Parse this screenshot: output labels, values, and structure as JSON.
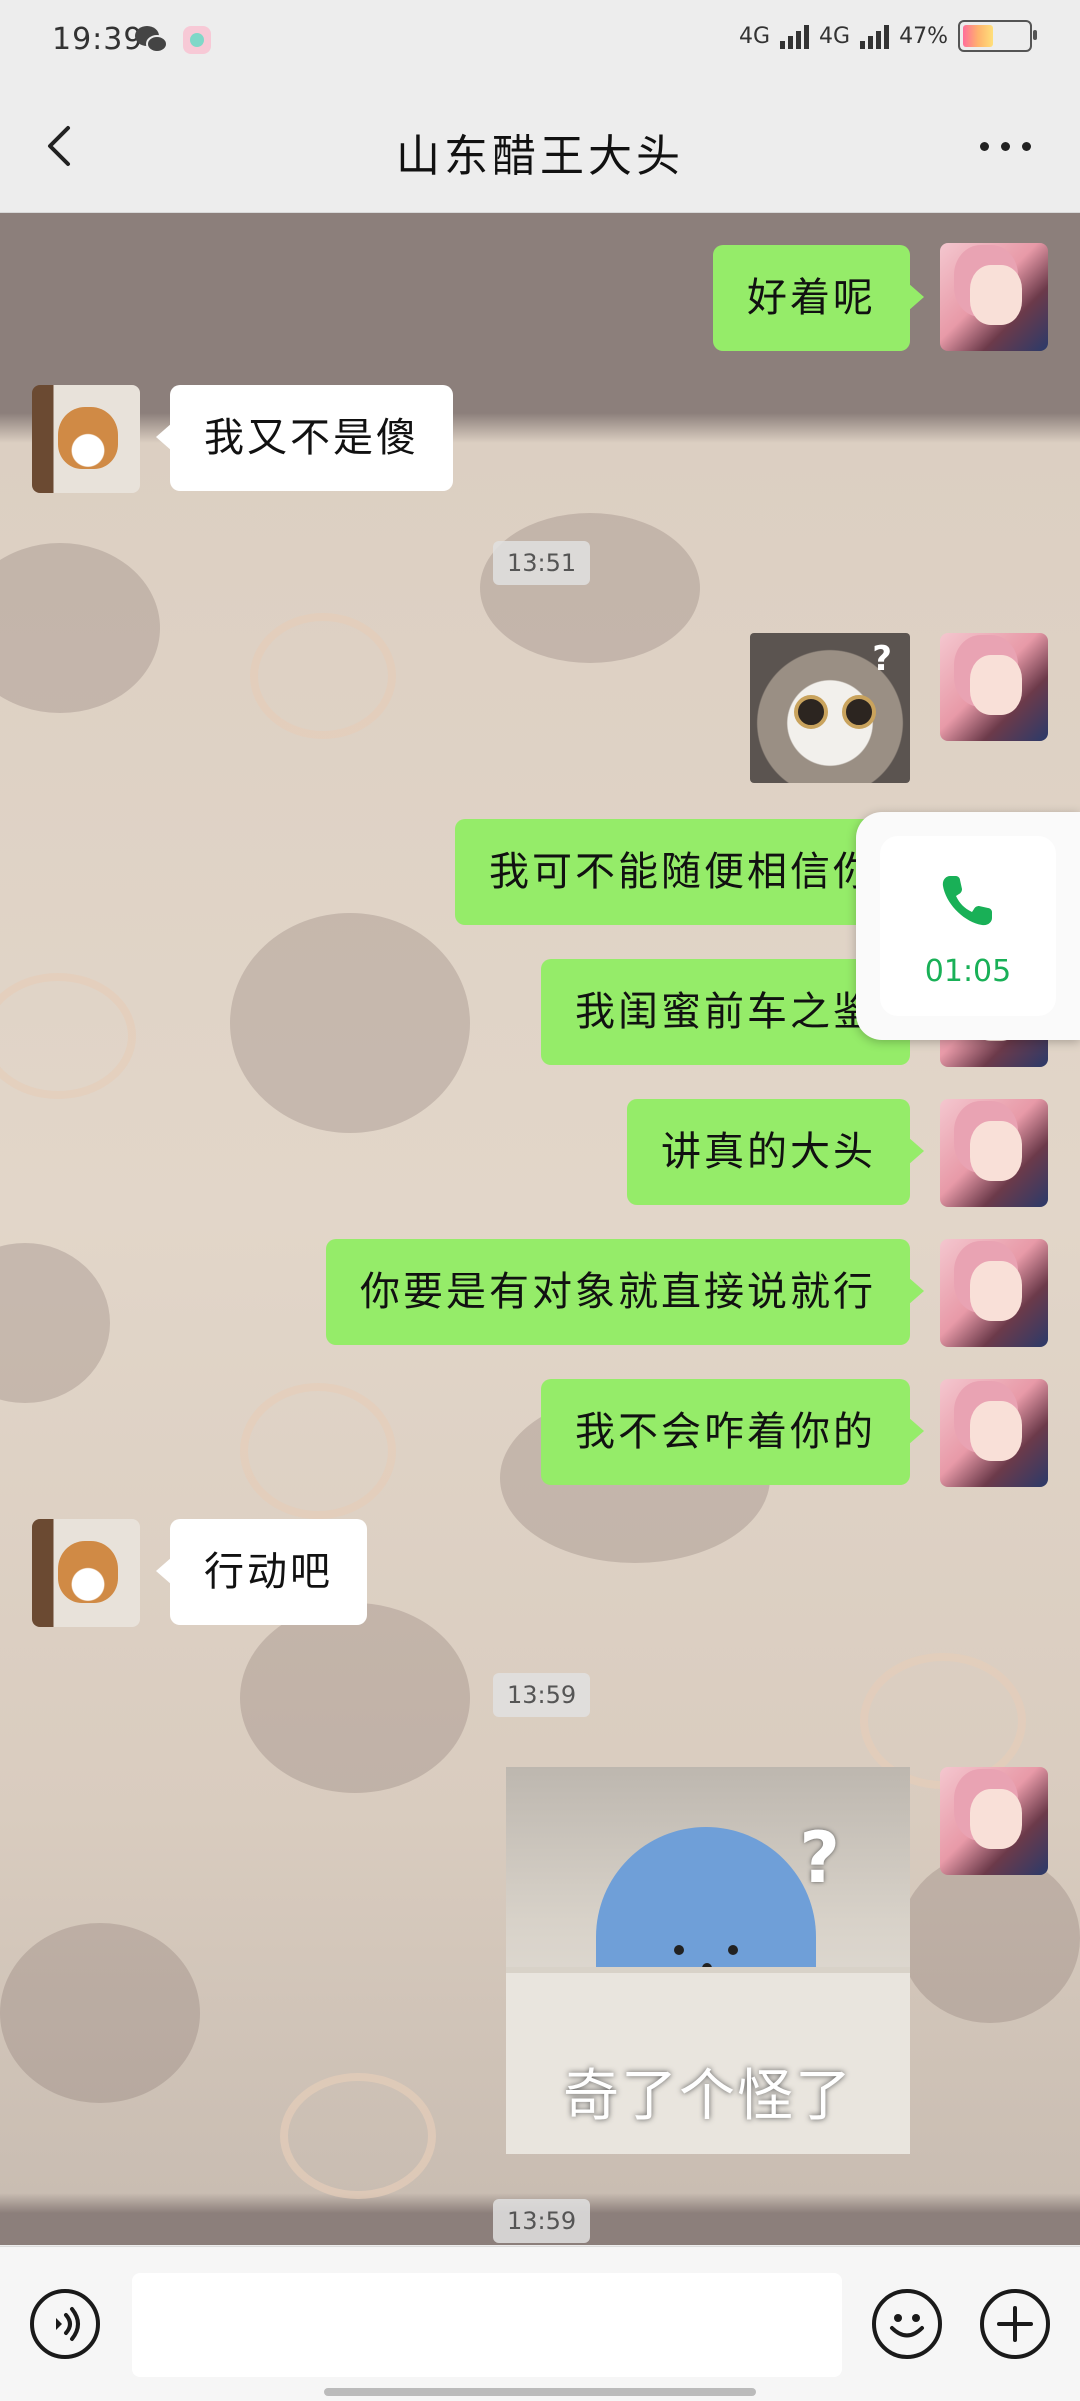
{
  "status_bar": {
    "time": "19:39",
    "signal1": "4G",
    "signal2": "4G",
    "battery": "47%",
    "battery_level": 0.47
  },
  "header": {
    "back_icon": "chevron-left-icon",
    "title": "山东醋王大头",
    "more_icon": "more-dots-icon"
  },
  "messages": [
    {
      "side": "me",
      "type": "text",
      "text": "好着呢"
    },
    {
      "side": "them",
      "type": "text",
      "text": "我又不是傻"
    },
    {
      "type": "time",
      "text": "13:51"
    },
    {
      "side": "me",
      "type": "sticker",
      "sticker": "surprised-cat",
      "text": "?"
    },
    {
      "side": "me",
      "type": "text",
      "text": "我可不能随便相信你"
    },
    {
      "side": "me",
      "type": "text",
      "text": "我闺蜜前车之鉴"
    },
    {
      "side": "me",
      "type": "text",
      "text": "讲真的大头"
    },
    {
      "side": "me",
      "type": "text",
      "text": "你要是有对象就直接说就行"
    },
    {
      "side": "me",
      "type": "text",
      "text": "我不会咋着你的"
    },
    {
      "side": "them",
      "type": "text",
      "text": "行动吧"
    },
    {
      "type": "time",
      "text": "13:59"
    },
    {
      "side": "me",
      "type": "sticker",
      "sticker": "blue-hat-in-bag",
      "text": "?",
      "caption": "奇了个怪了"
    },
    {
      "type": "time",
      "text": "13:59"
    }
  ],
  "call_widget": {
    "icon": "phone-icon",
    "duration": "01:05",
    "color": "#19b057"
  },
  "input_bar": {
    "voice_icon": "voice-icon",
    "emoji_icon": "emoji-icon",
    "plus_icon": "plus-icon"
  },
  "colors": {
    "my_bubble": "#95ec69",
    "their_bubble": "#ffffff",
    "header_bg": "#ededed"
  }
}
